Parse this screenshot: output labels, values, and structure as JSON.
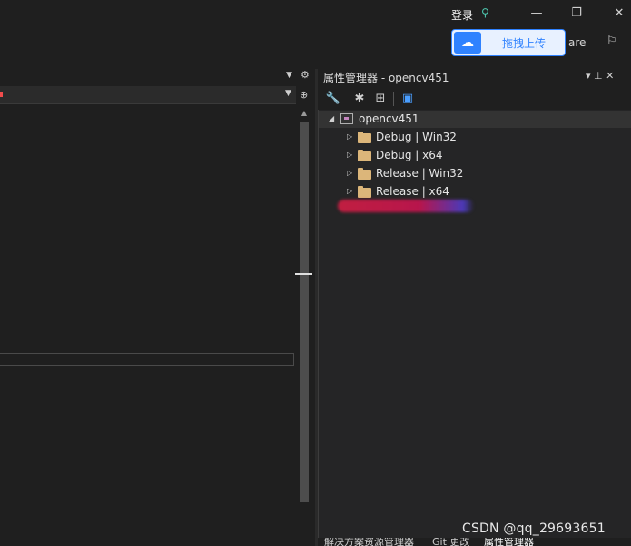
{
  "titlebar": {
    "login_label": "登录",
    "min_icon": "—",
    "restore_icon": "❐",
    "close_icon": "✕"
  },
  "upload_popup": {
    "label": "拖拽上传",
    "share_text": "are"
  },
  "property_manager": {
    "title": "属性管理器 - opencv451",
    "title_buttons": "▾  ⊥  ✕",
    "root": "opencv451",
    "configs": [
      "Debug | Win32",
      "Debug | x64",
      "Release | Win32",
      "Release | x64"
    ]
  },
  "bottom_tabs": [
    "解决方案资源管理器",
    "Git 更改",
    "属性管理器"
  ],
  "watermark": "CSDN @qq_29693651",
  "colors": {
    "background": "#1f1f1f",
    "tree_background": "#252526",
    "selected_row": "#333333",
    "folder": "#dcb67a",
    "baidu_blue": "#2f82ff"
  }
}
